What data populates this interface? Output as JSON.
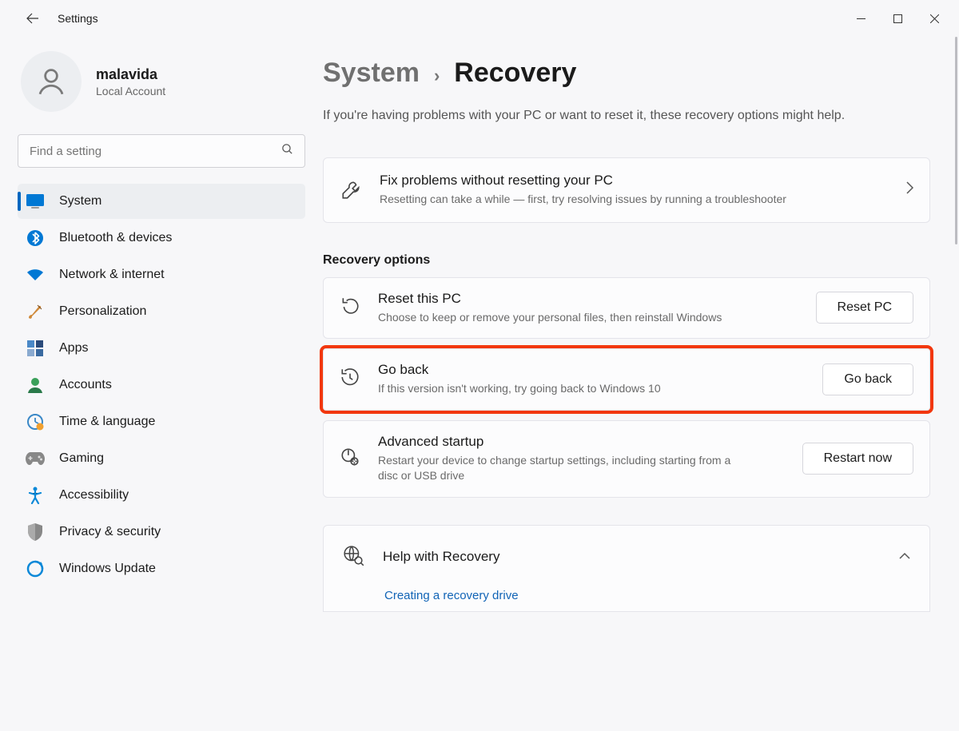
{
  "title": "Settings",
  "user": {
    "name": "malavida",
    "sub": "Local Account"
  },
  "search": {
    "placeholder": "Find a setting"
  },
  "nav": {
    "system": "System",
    "bluetooth": "Bluetooth & devices",
    "network": "Network & internet",
    "personalization": "Personalization",
    "apps": "Apps",
    "accounts": "Accounts",
    "time": "Time & language",
    "gaming": "Gaming",
    "accessibility": "Accessibility",
    "privacy": "Privacy & security",
    "update": "Windows Update"
  },
  "breadcrumb": {
    "parent": "System",
    "current": "Recovery"
  },
  "description": "If you're having problems with your PC or want to reset it, these recovery options might help.",
  "fix": {
    "title": "Fix problems without resetting your PC",
    "sub": "Resetting can take a while — first, try resolving issues by running a troubleshooter"
  },
  "section_heading": "Recovery options",
  "reset": {
    "title": "Reset this PC",
    "sub": "Choose to keep or remove your personal files, then reinstall Windows",
    "button": "Reset PC"
  },
  "goback": {
    "title": "Go back",
    "sub": "If this version isn't working, try going back to Windows 10",
    "button": "Go back"
  },
  "advanced": {
    "title": "Advanced startup",
    "sub": "Restart your device to change startup settings, including starting from a disc or USB drive",
    "button": "Restart now"
  },
  "help": {
    "title": "Help with Recovery",
    "link1": "Creating a recovery drive"
  }
}
